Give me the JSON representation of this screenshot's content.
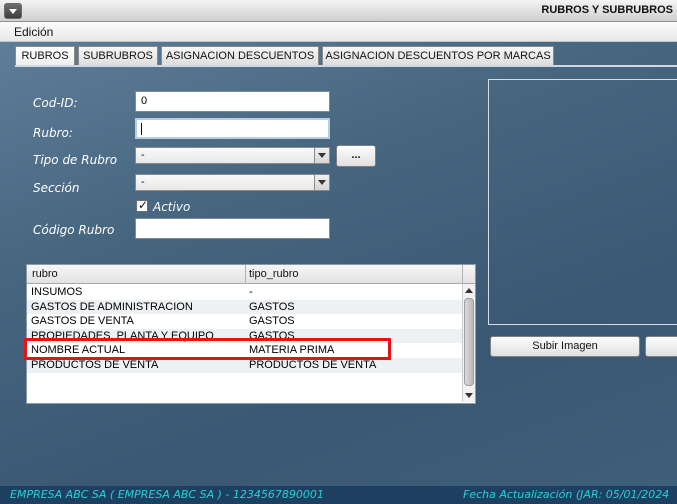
{
  "window": {
    "title": "RUBROS Y SUBRUBROS"
  },
  "menu": {
    "items": [
      "Edición"
    ]
  },
  "tabs": [
    {
      "label": "RUBROS",
      "active": true
    },
    {
      "label": "SUBRUBROS",
      "active": false
    },
    {
      "label": "ASIGNACION DESCUENTOS",
      "active": false
    },
    {
      "label": "ASIGNACION DESCUENTOS POR MARCAS",
      "active": false
    }
  ],
  "form": {
    "cod_id_label": "Cod-ID:",
    "cod_id_value": "0",
    "rubro_label": "Rubro:",
    "rubro_value": "",
    "tipo_label": "Tipo de Rubro",
    "tipo_value": "-",
    "browse_label": "...",
    "seccion_label": "Sección",
    "seccion_value": "-",
    "activo_label": "Activo",
    "activo_checked": true,
    "codigo_label": "Código Rubro",
    "codigo_value": ""
  },
  "table": {
    "columns": [
      "rubro",
      "tipo_rubro"
    ],
    "rows": [
      [
        "INSUMOS",
        "-"
      ],
      [
        "GASTOS DE ADMINISTRACION",
        "GASTOS"
      ],
      [
        "GASTOS DE VENTA",
        "GASTOS"
      ],
      [
        "PROPIEDADES, PLANTA Y EQUIPO",
        "GASTOS"
      ],
      [
        "NOMBRE ACTUAL",
        "MATERIA PRIMA"
      ],
      [
        "PRODUCTOS DE VENTA",
        "PRODUCTOS DE VENTA"
      ]
    ]
  },
  "image_panel": {
    "upload_label": "Subir Imagen"
  },
  "status": {
    "left": "EMPRESA ABC SA   (  EMPRESA ABC SA  )  -  1234567890001",
    "right": "Fecha Actualización (JAR: 05/01/2024"
  },
  "colors": {
    "highlight": "#e21414",
    "status_text": "#27d0d6",
    "status_bg": "#1d4060"
  }
}
